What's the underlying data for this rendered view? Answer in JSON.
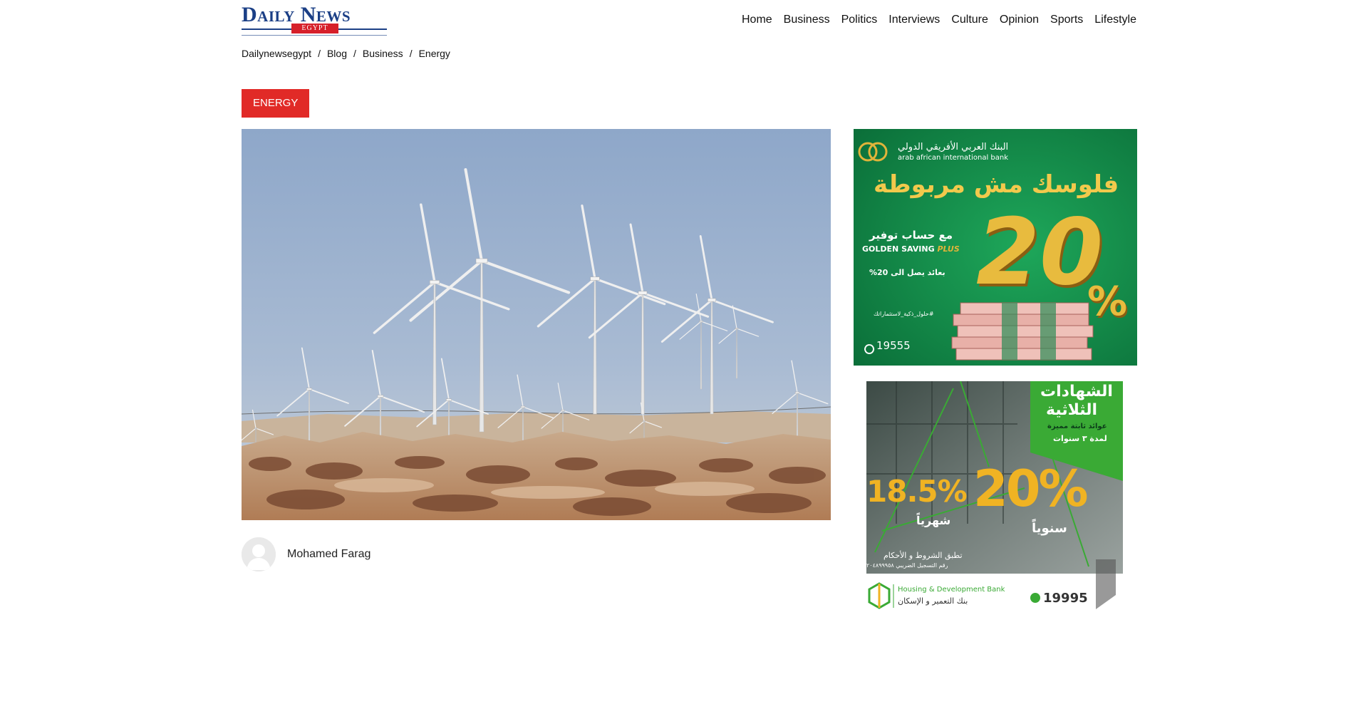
{
  "header": {
    "logo_main": "Daily News",
    "logo_sub": "EGYPT",
    "nav": [
      "Home",
      "Business",
      "Politics",
      "Interviews",
      "Culture",
      "Opinion",
      "Sports",
      "Lifestyle"
    ]
  },
  "breadcrumb": [
    "Dailynewsegypt",
    "Blog",
    "Business",
    "Energy"
  ],
  "category_badge": "ENERGY",
  "article": {
    "author": "Mohamed Farag"
  },
  "ads": {
    "ad1": {
      "bank_name_ar": "البنك العربي الأفريقي الدولي",
      "bank_name_en": "arab african international bank",
      "headline": "فلوسك مش مربوطة",
      "account_ar": "مع حساب توفير",
      "account_en": "GOLDEN SAVING",
      "account_en_accent": "PLUS",
      "return_line": "بعائد يصل الى 20%",
      "hashtag": "#حلول_ذكية_لاستثماراتك",
      "big_rate": "20",
      "percent": "%",
      "phone": "19555",
      "colors": {
        "bg": "#0d8a45",
        "gold": "#e0b43a"
      }
    },
    "ad2": {
      "title_line1": "الشهادات",
      "title_line2": "الثلاثية",
      "subtitle": "عوائد ثابتة مميزة",
      "duration": "لمدة ٣ سنوات",
      "rate_monthly": "18.5%",
      "label_monthly": "شهرياً",
      "rate_yearly": "20%",
      "label_yearly": "سنوياً",
      "terms": "تطبق الشروط و الأحكام",
      "tax": "رقم التسجيل الضريبي ٢٠٤٨٩٩٩٥٨",
      "bank_en": "Housing & Development Bank",
      "bank_ar": "بنك التعمير و الإسكان",
      "phone": "19995",
      "colors": {
        "green": "#3aaa35",
        "gold": "#f0b323"
      }
    }
  }
}
